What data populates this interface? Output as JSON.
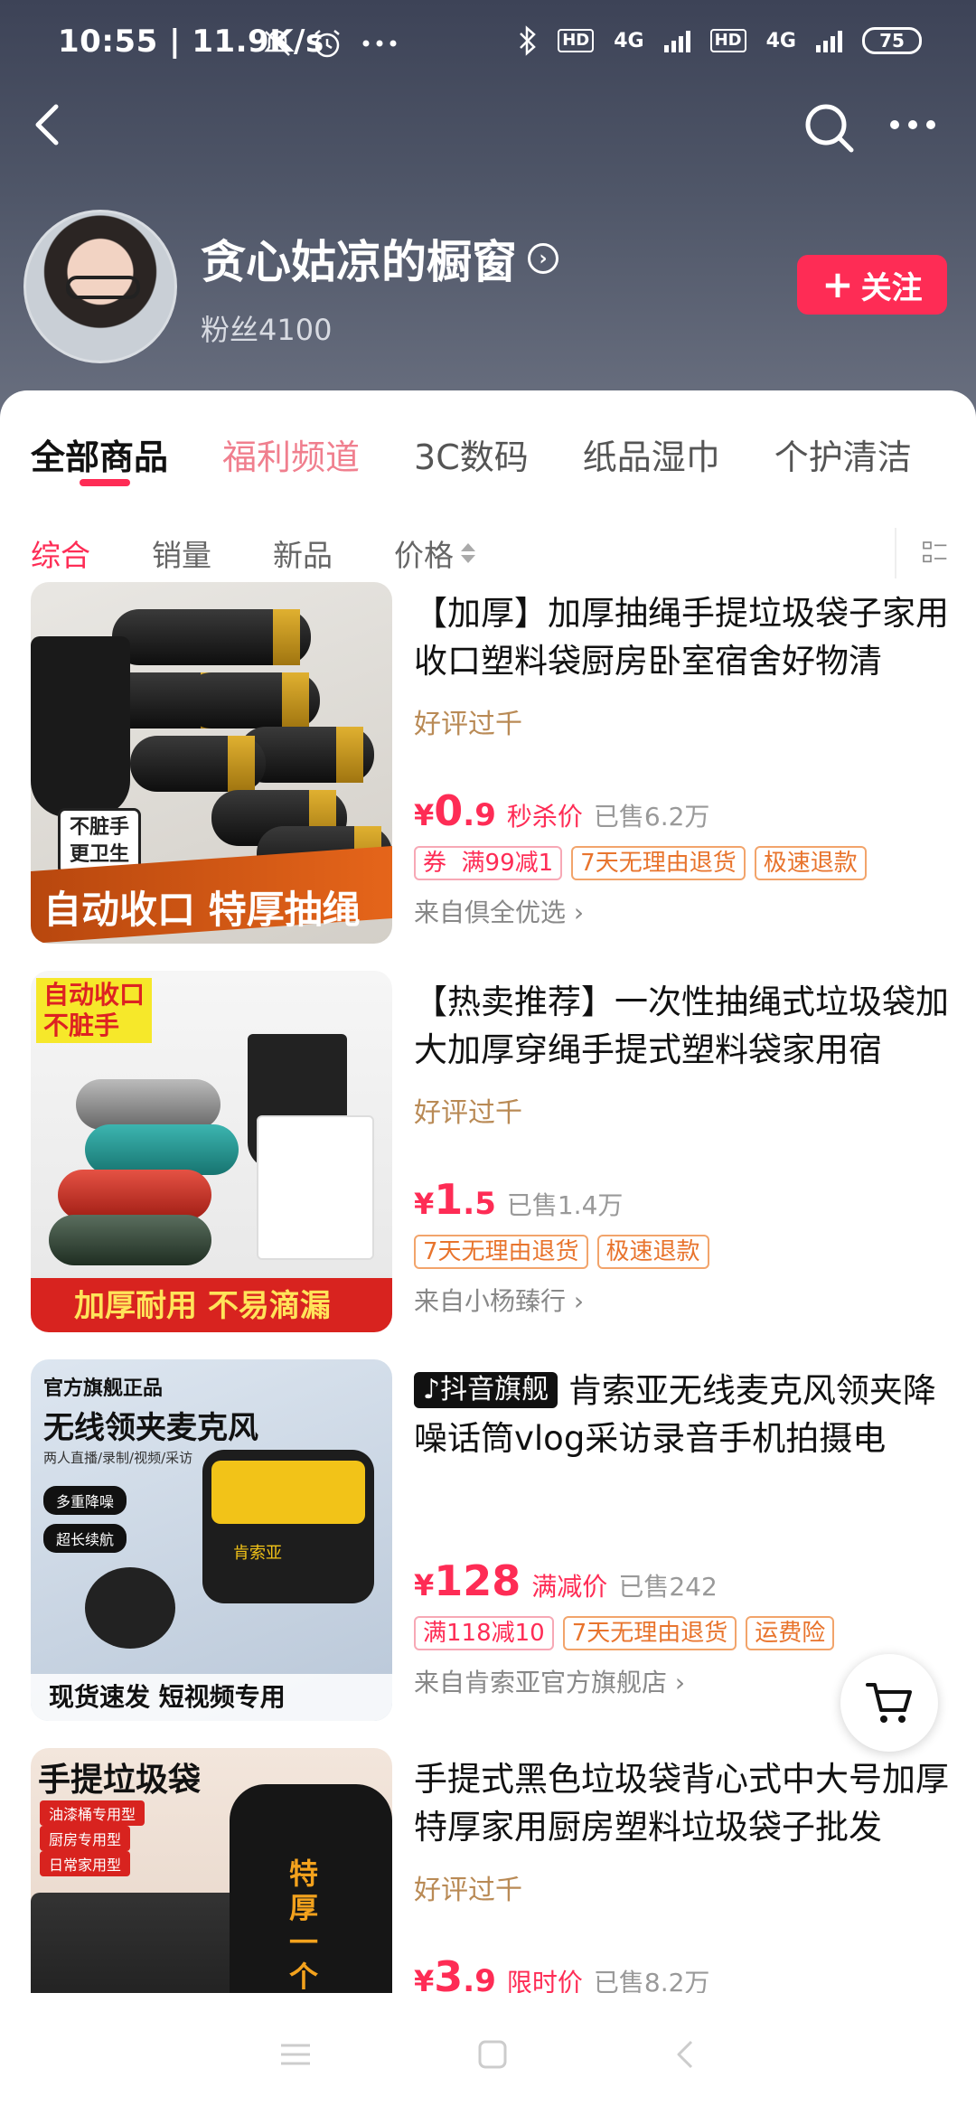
{
  "status_bar": {
    "time": "10:55 | 11.9K/s",
    "hd": "HD",
    "net": "4G",
    "battery": "75"
  },
  "shop": {
    "name": "贪心姑凉的橱窗",
    "fans": "粉丝4100",
    "follow_label": "关注"
  },
  "categories": [
    "全部商品",
    "福利频道",
    "3C数码",
    "纸品湿巾",
    "个护清洁"
  ],
  "filters": [
    "综合",
    "销量",
    "新品",
    "价格"
  ],
  "products": [
    {
      "title": "【加厚】加厚抽绳手提垃圾袋子家用收口塑料袋厨房卧室宿舍好物清",
      "review": "好评过千",
      "price_int": "0",
      "price_dec": ".9",
      "price_label": "秒杀价",
      "sold": "已售6.2万",
      "tags": [
        "券  满99减1",
        "7天无理由退货",
        "极速退款"
      ],
      "store": "来自倶全优选",
      "img_text_main": "自动收口 特厚抽绳",
      "img_text_side": "不脏手\n更卫生"
    },
    {
      "title": "【热卖推荐】一次性抽绳式垃圾袋加大加厚穿绳手提式塑料袋家用宿",
      "review": "好评过千",
      "price_int": "1",
      "price_dec": ".5",
      "price_label": "",
      "sold": "已售1.4万",
      "tags": [
        "7天无理由退货",
        "极速退款"
      ],
      "store": "来自小杨臻行",
      "img_text_main": "加厚耐用  不易滴漏",
      "img_text_side": "自动收口\n不脏手"
    },
    {
      "flagship": "抖音旗舰",
      "title": "肯索亚无线麦克风领夹降噪话筒vlog采访录音手机拍摄电",
      "review": "",
      "price_int": "128",
      "price_dec": "",
      "price_label": "满减价",
      "sold": "已售242",
      "tags": [
        "满118减10",
        "7天无理由退货",
        "运费险"
      ],
      "store": "来自肯索亚官方旗舰店",
      "img_text_top": "官方旗舰正品",
      "img_text_title": "无线领夹麦克风",
      "img_text_sub": "两人直播/录制/视频/采访",
      "img_pill1": "多重降噪",
      "img_pill2": "超长续航",
      "img_text_main": "现货速发  短视频专用",
      "img_text_brand": "肯索亚"
    },
    {
      "title": "手提式黑色垃圾袋背心式中大号加厚特厚家用厨房塑料垃圾袋子批发",
      "review": "好评过千",
      "price_int": "3",
      "price_dec": ".9",
      "price_label": "限时价",
      "sold": "已售8.2万",
      "tags": [],
      "store": "",
      "img_text_main": "手提垃圾袋",
      "img_lines": [
        "油漆桶专用型",
        "厨房专用型",
        "日常家用型"
      ],
      "img_text_side": "特厚一个"
    }
  ],
  "colors": {
    "accent": "#fe2c55",
    "review": "#b98a55",
    "tag_orange": "#e8742d"
  }
}
